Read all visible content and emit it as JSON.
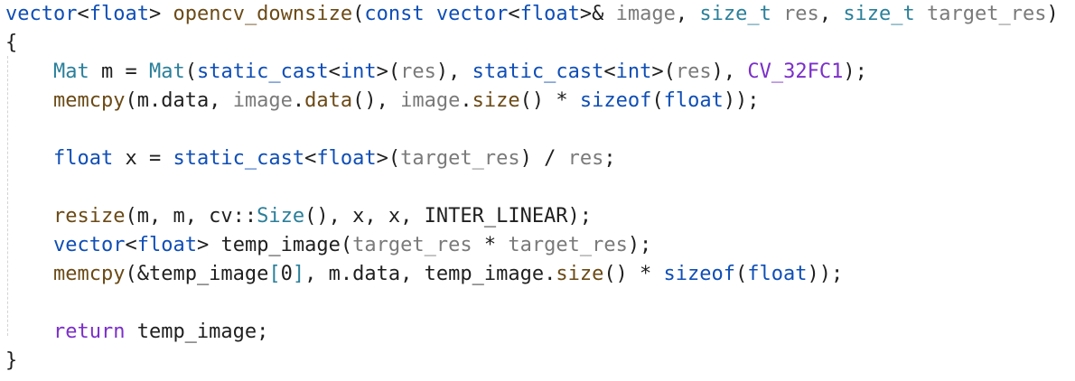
{
  "colors": {
    "background": "#ffffff",
    "plain": "#1f1f1f",
    "keyword": "#0f4eb6",
    "function": "#6b4a16",
    "parameter": "#7a7a7a",
    "type_param": "#2a7f9a",
    "macro": "#7b2fc9",
    "comment_guide": "#d4d4d4"
  },
  "code": {
    "lines": [
      {
        "tokens": [
          {
            "t": "vector",
            "c": "keyword"
          },
          {
            "t": "<",
            "c": "plain"
          },
          {
            "t": "float",
            "c": "keyword"
          },
          {
            "t": "> ",
            "c": "plain"
          },
          {
            "t": "opencv_downsize",
            "c": "function"
          },
          {
            "t": "(",
            "c": "plain"
          },
          {
            "t": "const ",
            "c": "keyword"
          },
          {
            "t": "vector",
            "c": "keyword"
          },
          {
            "t": "<",
            "c": "plain"
          },
          {
            "t": "float",
            "c": "keyword"
          },
          {
            "t": ">& ",
            "c": "plain"
          },
          {
            "t": "image",
            "c": "parameter"
          },
          {
            "t": ", ",
            "c": "plain"
          },
          {
            "t": "size_t ",
            "c": "type_param"
          },
          {
            "t": "res",
            "c": "parameter"
          },
          {
            "t": ", ",
            "c": "plain"
          },
          {
            "t": "size_t ",
            "c": "type_param"
          },
          {
            "t": "target_res",
            "c": "parameter"
          },
          {
            "t": ")",
            "c": "plain"
          }
        ]
      },
      {
        "tokens": [
          {
            "t": "{",
            "c": "plain"
          }
        ]
      },
      {
        "tokens": [
          {
            "t": "    ",
            "c": "plain"
          },
          {
            "t": "Mat ",
            "c": "type_param"
          },
          {
            "t": "m = ",
            "c": "plain"
          },
          {
            "t": "Mat",
            "c": "type_param"
          },
          {
            "t": "(",
            "c": "plain"
          },
          {
            "t": "static_cast",
            "c": "keyword"
          },
          {
            "t": "<",
            "c": "plain"
          },
          {
            "t": "int",
            "c": "keyword"
          },
          {
            "t": ">(",
            "c": "plain"
          },
          {
            "t": "res",
            "c": "parameter"
          },
          {
            "t": "), ",
            "c": "plain"
          },
          {
            "t": "static_cast",
            "c": "keyword"
          },
          {
            "t": "<",
            "c": "plain"
          },
          {
            "t": "int",
            "c": "keyword"
          },
          {
            "t": ">(",
            "c": "plain"
          },
          {
            "t": "res",
            "c": "parameter"
          },
          {
            "t": "), ",
            "c": "plain"
          },
          {
            "t": "CV_32FC1",
            "c": "macro"
          },
          {
            "t": ");",
            "c": "plain"
          }
        ]
      },
      {
        "tokens": [
          {
            "t": "    ",
            "c": "plain"
          },
          {
            "t": "memcpy",
            "c": "function"
          },
          {
            "t": "(m.data, ",
            "c": "plain"
          },
          {
            "t": "image",
            "c": "parameter"
          },
          {
            "t": ".",
            "c": "plain"
          },
          {
            "t": "data",
            "c": "function"
          },
          {
            "t": "(), ",
            "c": "plain"
          },
          {
            "t": "image",
            "c": "parameter"
          },
          {
            "t": ".",
            "c": "plain"
          },
          {
            "t": "size",
            "c": "function"
          },
          {
            "t": "() * ",
            "c": "plain"
          },
          {
            "t": "sizeof",
            "c": "keyword"
          },
          {
            "t": "(",
            "c": "plain"
          },
          {
            "t": "float",
            "c": "keyword"
          },
          {
            "t": "));",
            "c": "plain"
          }
        ]
      },
      {
        "tokens": []
      },
      {
        "tokens": [
          {
            "t": "    ",
            "c": "plain"
          },
          {
            "t": "float ",
            "c": "keyword"
          },
          {
            "t": "x = ",
            "c": "plain"
          },
          {
            "t": "static_cast",
            "c": "keyword"
          },
          {
            "t": "<",
            "c": "plain"
          },
          {
            "t": "float",
            "c": "keyword"
          },
          {
            "t": ">(",
            "c": "plain"
          },
          {
            "t": "target_res",
            "c": "parameter"
          },
          {
            "t": ") / ",
            "c": "plain"
          },
          {
            "t": "res",
            "c": "parameter"
          },
          {
            "t": ";",
            "c": "plain"
          }
        ]
      },
      {
        "tokens": []
      },
      {
        "tokens": [
          {
            "t": "    ",
            "c": "plain"
          },
          {
            "t": "resize",
            "c": "function"
          },
          {
            "t": "(m, m, cv::",
            "c": "plain"
          },
          {
            "t": "Size",
            "c": "type_param"
          },
          {
            "t": "(), x, x, INTER_LINEAR);",
            "c": "plain"
          }
        ]
      },
      {
        "tokens": [
          {
            "t": "    ",
            "c": "plain"
          },
          {
            "t": "vector",
            "c": "keyword"
          },
          {
            "t": "<",
            "c": "plain"
          },
          {
            "t": "float",
            "c": "keyword"
          },
          {
            "t": "> ",
            "c": "plain"
          },
          {
            "t": "temp_image",
            "c": "plain"
          },
          {
            "t": "(",
            "c": "plain"
          },
          {
            "t": "target_res",
            "c": "parameter"
          },
          {
            "t": " * ",
            "c": "plain"
          },
          {
            "t": "target_res",
            "c": "parameter"
          },
          {
            "t": ");",
            "c": "plain"
          }
        ]
      },
      {
        "tokens": [
          {
            "t": "    ",
            "c": "plain"
          },
          {
            "t": "memcpy",
            "c": "function"
          },
          {
            "t": "(&temp_image",
            "c": "plain"
          },
          {
            "t": "[",
            "c": "type_param"
          },
          {
            "t": "0",
            "c": "plain"
          },
          {
            "t": "]",
            "c": "type_param"
          },
          {
            "t": ", m.data, temp_image.",
            "c": "plain"
          },
          {
            "t": "size",
            "c": "function"
          },
          {
            "t": "() * ",
            "c": "plain"
          },
          {
            "t": "sizeof",
            "c": "keyword"
          },
          {
            "t": "(",
            "c": "plain"
          },
          {
            "t": "float",
            "c": "keyword"
          },
          {
            "t": "));",
            "c": "plain"
          }
        ]
      },
      {
        "tokens": []
      },
      {
        "tokens": [
          {
            "t": "    ",
            "c": "plain"
          },
          {
            "t": "return ",
            "c": "macro"
          },
          {
            "t": "temp_image;",
            "c": "plain"
          }
        ]
      },
      {
        "tokens": [
          {
            "t": "}",
            "c": "plain"
          }
        ]
      }
    ]
  }
}
